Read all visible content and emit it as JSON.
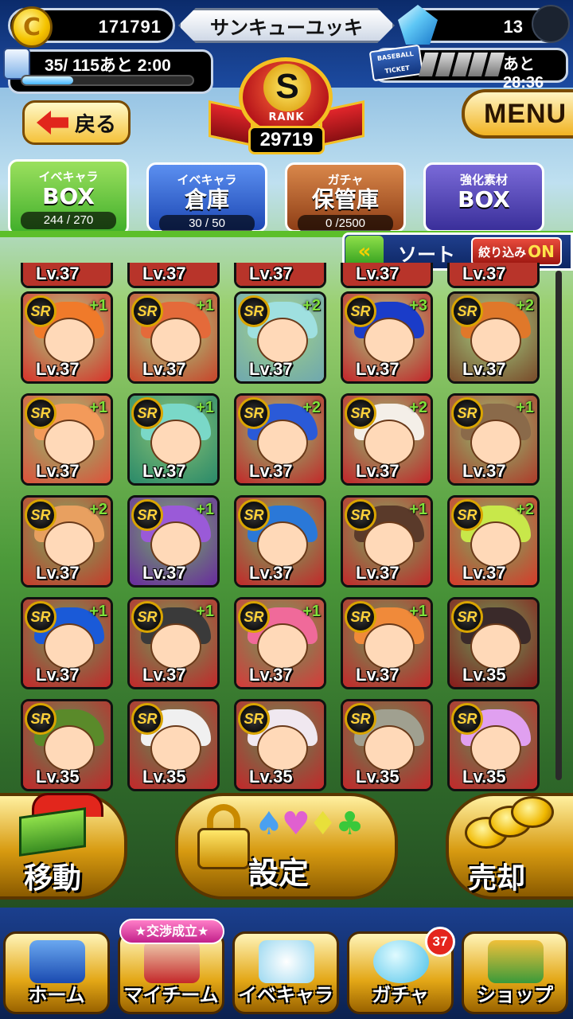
{
  "header": {
    "coins": "171791",
    "player_name": "サンキューユッキ",
    "gems": "13",
    "stamina_text": "35/ 115あと 2:00",
    "stamina_fraction": 0.3,
    "ticket_label": "BASEBALL TICKET",
    "ticket_time": "あと28:36",
    "rank_letter": "S",
    "rank_label": "RANK",
    "rank_value": "29719",
    "back_label": "戻る",
    "menu_label": "MENU"
  },
  "tabs": [
    {
      "top": "イベキャラ",
      "main": "BOX",
      "count": "244 / 270"
    },
    {
      "top": "イベキャラ",
      "main": "倉庫",
      "count": "30 / 50"
    },
    {
      "top": "ガチャ",
      "main": "保管庫",
      "count": "0 /2500"
    },
    {
      "top": "強化素材",
      "main": "BOX",
      "count": ""
    }
  ],
  "sort": {
    "label": "ソート",
    "filter": "絞り込み",
    "filter_state": "ON"
  },
  "grid": {
    "top_row_levels": [
      "Lv.37",
      "Lv.37",
      "Lv.37",
      "Lv.37",
      "Lv.37"
    ],
    "rows": [
      [
        {
          "rarity": "SR",
          "plus": "+1",
          "lv": "Lv.37",
          "hair": "#f07a2a",
          "bg": "#d9322a"
        },
        {
          "rarity": "SR",
          "plus": "+1",
          "lv": "Lv.37",
          "hair": "#e46a3a",
          "bg": "#c9432a"
        },
        {
          "rarity": "SR",
          "plus": "+2",
          "lv": "Lv.37",
          "hair": "#9fe0e0",
          "bg": "#6fa8b0"
        },
        {
          "rarity": "SR",
          "plus": "+3",
          "lv": "Lv.37",
          "hair": "#1a3cc9",
          "bg": "#c4242a"
        },
        {
          "rarity": "SR",
          "plus": "+2",
          "lv": "Lv.37",
          "hair": "#e0782a",
          "bg": "#7a4a2a"
        }
      ],
      [
        {
          "rarity": "SR",
          "plus": "+1",
          "lv": "Lv.37",
          "hair": "#f39a5a",
          "bg": "#e0503a"
        },
        {
          "rarity": "SR",
          "plus": "+1",
          "lv": "Lv.37",
          "hair": "#7ad8c8",
          "bg": "#2a8a6a"
        },
        {
          "rarity": "SR",
          "plus": "+2",
          "lv": "Lv.37",
          "hair": "#2a5ad8",
          "bg": "#c4282a"
        },
        {
          "rarity": "SR",
          "plus": "+2",
          "lv": "Lv.37",
          "hair": "#f4efe8",
          "bg": "#c4242a"
        },
        {
          "rarity": "SR",
          "plus": "+1",
          "lv": "Lv.37",
          "hair": "#8a6a4a",
          "bg": "#b03a2a"
        }
      ],
      [
        {
          "rarity": "SR",
          "plus": "+2",
          "lv": "Lv.37",
          "hair": "#e8a060",
          "bg": "#c83a2a"
        },
        {
          "rarity": "SR",
          "plus": "+1",
          "lv": "Lv.37",
          "hair": "#9a5ad8",
          "bg": "#6a2aa0"
        },
        {
          "rarity": "SR",
          "plus": "",
          "lv": "Lv.37",
          "hair": "#2a78d8",
          "bg": "#c4282a"
        },
        {
          "rarity": "SR",
          "plus": "+1",
          "lv": "Lv.37",
          "hair": "#5a3a2a",
          "bg": "#c4282a"
        },
        {
          "rarity": "SR",
          "plus": "+2",
          "lv": "Lv.37",
          "hair": "#c8e84a",
          "bg": "#d83a2a"
        }
      ],
      [
        {
          "rarity": "SR",
          "plus": "+1",
          "lv": "Lv.37",
          "hair": "#1a5ad8",
          "bg": "#c4282a"
        },
        {
          "rarity": "SR",
          "plus": "+1",
          "lv": "Lv.37",
          "hair": "#3a3a3a",
          "bg": "#c4282a"
        },
        {
          "rarity": "SR",
          "plus": "+1",
          "lv": "Lv.37",
          "hair": "#f06a9a",
          "bg": "#d83a3a"
        },
        {
          "rarity": "SR",
          "plus": "+1",
          "lv": "Lv.37",
          "hair": "#f08a3a",
          "bg": "#c4282a"
        },
        {
          "rarity": "SR",
          "plus": "",
          "lv": "Lv.35",
          "hair": "#3a2a2a",
          "bg": "#8a1a1a"
        }
      ],
      [
        {
          "rarity": "SR",
          "plus": "",
          "lv": "Lv.35",
          "hair": "#5a8a2a",
          "bg": "#c4282a"
        },
        {
          "rarity": "SR",
          "plus": "",
          "lv": "Lv.35",
          "hair": "#f0f0f0",
          "bg": "#c4282a"
        },
        {
          "rarity": "SR",
          "plus": "",
          "lv": "Lv.35",
          "hair": "#f0e8f0",
          "bg": "#c4282a"
        },
        {
          "rarity": "SR",
          "plus": "",
          "lv": "Lv.35",
          "hair": "#a0a090",
          "bg": "#c4282a"
        },
        {
          "rarity": "SR",
          "plus": "",
          "lv": "Lv.35",
          "hair": "#e0a0f0",
          "bg": "#c4282a"
        }
      ]
    ]
  },
  "actions": {
    "move": "移動",
    "settings": "設定",
    "settings_suits": "♠♥♦♣",
    "sell": "売却"
  },
  "nav": {
    "home": "ホーム",
    "team": "マイチーム",
    "team_badge": "★交渉成立★",
    "chara": "イベキャラ",
    "gacha": "ガチャ",
    "gacha_badge": "37",
    "shop": "ショップ"
  }
}
